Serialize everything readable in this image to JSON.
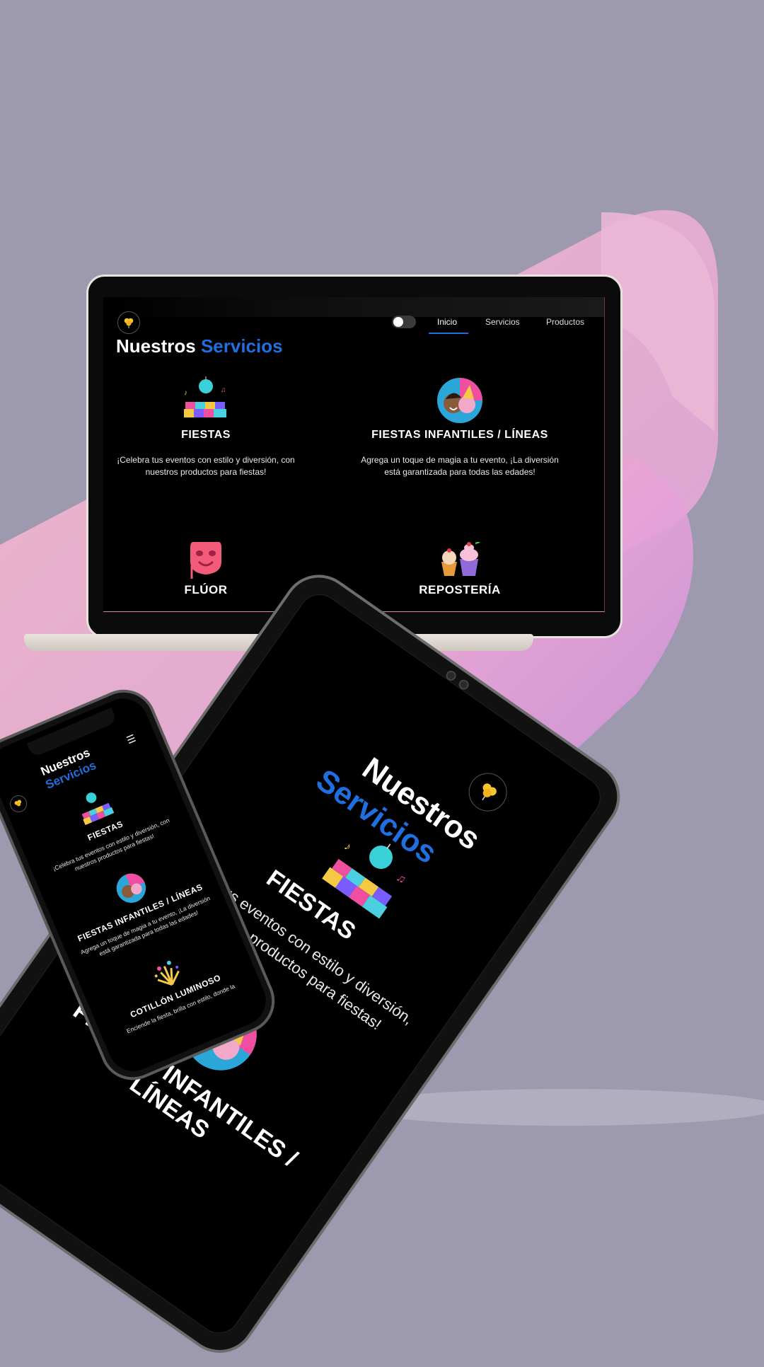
{
  "brand": {
    "logo_alt": "balloon-logo"
  },
  "heading": {
    "part1": "Nuestros",
    "part2": "Servicios"
  },
  "nav": {
    "items": [
      {
        "label": "Inicio",
        "active": true
      },
      {
        "label": "Servicios",
        "active": false
      },
      {
        "label": "Productos",
        "active": false
      }
    ],
    "theme_toggle": "moon-icon"
  },
  "services": [
    {
      "title": "FIESTAS",
      "description": "¡Celebra tus eventos con estilo y diversión, con nuestros productos para fiestas!",
      "icon": "disco-floor-icon"
    },
    {
      "title": "FIESTAS INFANTILES / LÍNEAS",
      "description": "Agrega un toque de magia a tu evento, ¡La diversión está garantizada para todas las edades!",
      "icon": "party-kids-icon"
    },
    {
      "title": "FLÚOR",
      "description": "",
      "icon": "neon-mask-icon"
    },
    {
      "title": "REPOSTERÍA",
      "description": "",
      "icon": "cupcakes-icon"
    },
    {
      "title": "COTILLÓN LUMINOSO",
      "description": "Enciende la fiesta, brilla con estilo, donde la",
      "icon": "fireworks-icon"
    }
  ],
  "colors": {
    "accent": "#1f6fe0",
    "background": "#9d99ae",
    "screen": "#000000"
  }
}
